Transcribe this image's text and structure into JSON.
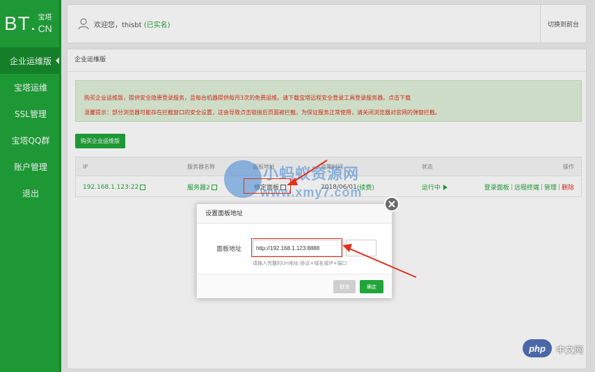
{
  "logo": {
    "text": "BT",
    "dot": ".",
    "cn_top": "宝塔",
    "cn": "CN"
  },
  "sidebar": {
    "items": [
      {
        "label": "企业运维版",
        "active": true
      },
      {
        "label": "宝塔运维"
      },
      {
        "label": "SSL管理"
      },
      {
        "label": "宝塔QQ群"
      },
      {
        "label": "账户管理"
      },
      {
        "label": "退出"
      }
    ]
  },
  "header": {
    "welcome": "欢迎您，thisbt",
    "verified": "(已实名)",
    "switch_label": "切换到前台"
  },
  "panel": {
    "title": "企业运维版",
    "notice_line1": "购买企业运维版，提供安全隐患登录服务，且每台机器提供每月3次的免费运维。请下载宝塔远程安全登录工具登录服务器。",
    "notice_link": "点击下载",
    "notice_line2": "温馨提示：部分浏览器可能存在拦截窗口的安全设置，这会导致点击链接后页面被拦截，为保证服务正常使用，请关闭浏览器对官网的弹窗拦截。",
    "buy_button": "购买企业运维版"
  },
  "table": {
    "headers": [
      "IP",
      "服务器名称",
      "面板地址",
      "到期时间",
      "状态",
      "操作"
    ],
    "row": {
      "ip": "192.168.1.123:22",
      "server_name": "服务器2",
      "panel_addr": "绑定面板",
      "expire": "2018/06/01",
      "renew": "(续费)",
      "status": "运行中",
      "action_login": "登录面板",
      "action_remote": "远程终端",
      "action_manage": "管理",
      "action_delete": "删除",
      "sep": "|"
    }
  },
  "dialog": {
    "title": "设置面板地址",
    "field_label": "面板地址",
    "url_value": "http://192.168.1.123:8888",
    "hint": "请输入完整的Url地址:协议+域名或IP+端口",
    "cancel": "取消",
    "confirm": "确定"
  },
  "watermark": {
    "line1": "小蚂蚁资源网",
    "line2": "www.xmy7.com"
  },
  "badge": {
    "php": "php",
    "site": "中文网"
  },
  "colors": {
    "green": "#20a53a",
    "red": "#e0301e",
    "notice_bg": "#dff0d8",
    "watermark": "#3f86d3"
  }
}
